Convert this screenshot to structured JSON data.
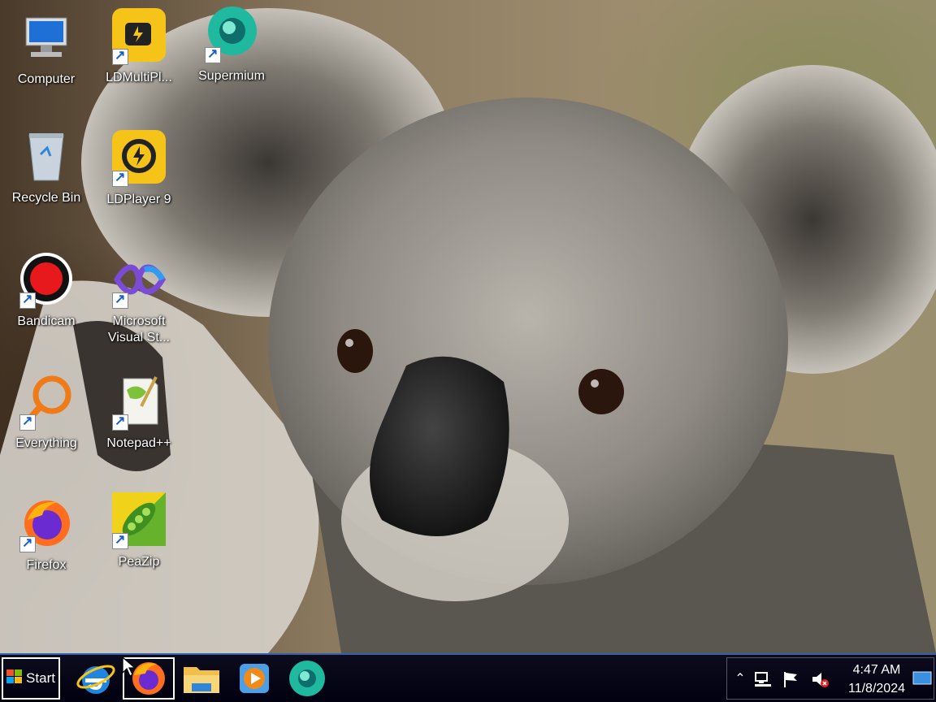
{
  "desktop": {
    "icons": [
      {
        "label": "Computer"
      },
      {
        "label": "LDMultiPl..."
      },
      {
        "label": "Supermium"
      },
      {
        "label": "Recycle Bin"
      },
      {
        "label": "LDPlayer 9"
      },
      {
        "label": "Bandicam"
      },
      {
        "label": "Microsoft\nVisual St..."
      },
      {
        "label": "Everything"
      },
      {
        "label": "Notepad++"
      },
      {
        "label": "Firefox"
      },
      {
        "label": "PeaZip"
      }
    ]
  },
  "taskbar": {
    "start_label": "Start",
    "pinned": [
      "internet-explorer-icon",
      "firefox-icon",
      "file-explorer-icon",
      "media-player-icon",
      "supermium-icon"
    ],
    "clock": {
      "time": "4:47 AM",
      "date": "11/8/2024"
    },
    "tray_icons": [
      "show-hidden-icons-chevron",
      "network-icon",
      "action-center-flag-icon",
      "volume-muted-icon",
      "show-desktop-icon"
    ]
  },
  "colors": {
    "taskbar": "#000010",
    "taskbar_border": "#3a5ea8",
    "icon_label": "#ffffff"
  }
}
